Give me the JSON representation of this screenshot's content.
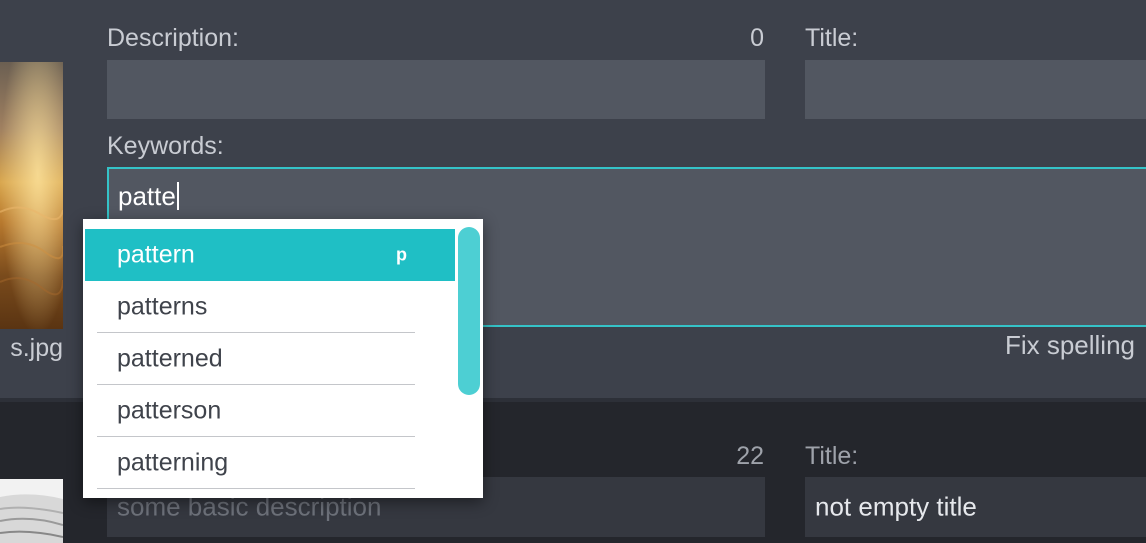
{
  "item1": {
    "filename_fragment": "s.jpg",
    "description_label": "Description:",
    "description_count": "0",
    "description_value": "",
    "title_label": "Title:",
    "title_value": "",
    "keywords_label": "Keywords:",
    "keywords_input": "patte",
    "fix_spelling": "Fix spelling"
  },
  "autocomplete": {
    "suggestions": [
      "pattern",
      "patterns",
      "patterned",
      "patterson",
      "patterning"
    ],
    "selected_index": 0,
    "selected_hint": "p"
  },
  "item2": {
    "description_count": "22",
    "description_value": "some basic description",
    "title_label": "Title:",
    "title_value": "not empty title"
  },
  "colors": {
    "accent": "#1fbfc5",
    "panel": "#3d414b",
    "field": "#525761",
    "dark_panel": "#24262c"
  }
}
